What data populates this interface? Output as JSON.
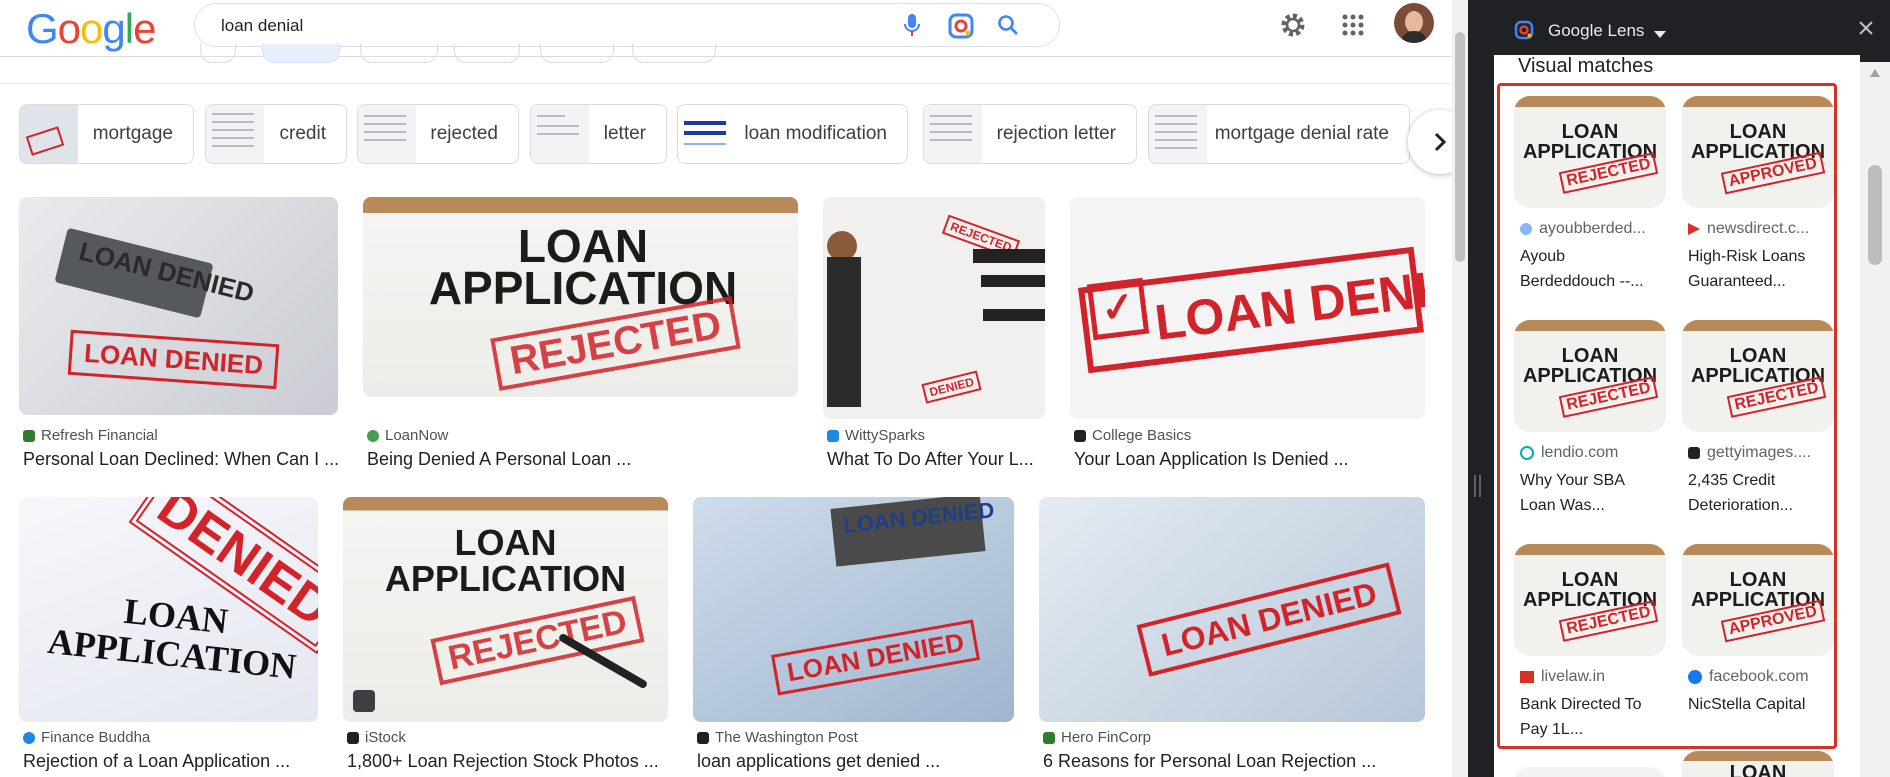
{
  "search": {
    "query": "loan denial"
  },
  "logo": {
    "text": "Google"
  },
  "chips": [
    {
      "label": "mortgage"
    },
    {
      "label": "credit"
    },
    {
      "label": "rejected"
    },
    {
      "label": "letter"
    },
    {
      "label": "loan modification"
    },
    {
      "label": "rejection letter"
    },
    {
      "label": "mortgage denial rate"
    }
  ],
  "results_row1": [
    {
      "source": "Refresh Financial",
      "title": "Personal Loan Declined: When Can I ...",
      "image_text": "LOAN DENIED",
      "fav_color": "#2e7d32"
    },
    {
      "source": "LoanNow",
      "title": "Being Denied A Personal Loan ...",
      "image_text": "LOAN APPLICATION",
      "stamp": "REJECTED",
      "fav_color": "#43a047"
    },
    {
      "source": "WittySparks",
      "title": "What To Do After Your L...",
      "stamp": "REJECTED",
      "stamp2": "DENIED",
      "fav_color": "#1e88e5"
    },
    {
      "source": "College Basics",
      "title": "Your Loan Application Is Denied ...",
      "image_text": "LOAN DENIED",
      "fav_color": "#212121"
    }
  ],
  "results_row2": [
    {
      "source": "Finance Buddha",
      "title": "Rejection of a Loan Application ...",
      "image_text": "LOAN APPLICATION",
      "stamp": "DENIED",
      "fav_color": "#1e88e5"
    },
    {
      "source": "iStock",
      "title": "1,800+ Loan Rejection Stock Photos ...",
      "image_text": "LOAN APPLICATION",
      "stamp": "REJECTED",
      "fav_color": "#212121"
    },
    {
      "source": "The Washington Post",
      "title": "loan applications get denied ...",
      "image_text": "LOAN DENIED",
      "fav_color": "#212121"
    },
    {
      "source": "Hero FinCorp",
      "title": "6 Reasons for Personal Loan Rejection ...",
      "image_text": "LOAN DENIED",
      "fav_color": "#2e7d32"
    }
  ],
  "lens": {
    "title": "Google Lens",
    "section_title": "Visual matches",
    "matches": [
      {
        "source": "ayoubberded...",
        "title_line1": "Ayoub",
        "title_line2": "Berdeddouch --...",
        "stamp": "REJECTED",
        "fav_color": "#8ab4f8"
      },
      {
        "source": "newsdirect.c...",
        "title_line1": "High-Risk Loans",
        "title_line2": "Guaranteed...",
        "stamp": "APPROVED",
        "fav_color": "#d93025"
      },
      {
        "source": "lendio.com",
        "title_line1": "Why Your SBA",
        "title_line2": "Loan Was...",
        "stamp": "REJECTED",
        "fav_color": "#00acc1"
      },
      {
        "source": "gettyimages....",
        "title_line1": "2,435 Credit",
        "title_line2": "Deterioration...",
        "stamp": "REJECTED",
        "fav_color": "#202124"
      },
      {
        "source": "livelaw.in",
        "title_line1": "Bank Directed To",
        "title_line2": "Pay 1L...",
        "stamp": "REJECTED",
        "fav_color": "#d93025"
      },
      {
        "source": "facebook.com",
        "title_line1": "NicStella Capital",
        "title_line2": "",
        "stamp": "APPROVED",
        "fav_color": "#1877f2"
      }
    ],
    "card_text": "LOAN APPLICATION"
  },
  "colors": {
    "accent_red": "#d93025",
    "stamp_red": "#d2232a",
    "link_blue": "#1a73e8"
  }
}
